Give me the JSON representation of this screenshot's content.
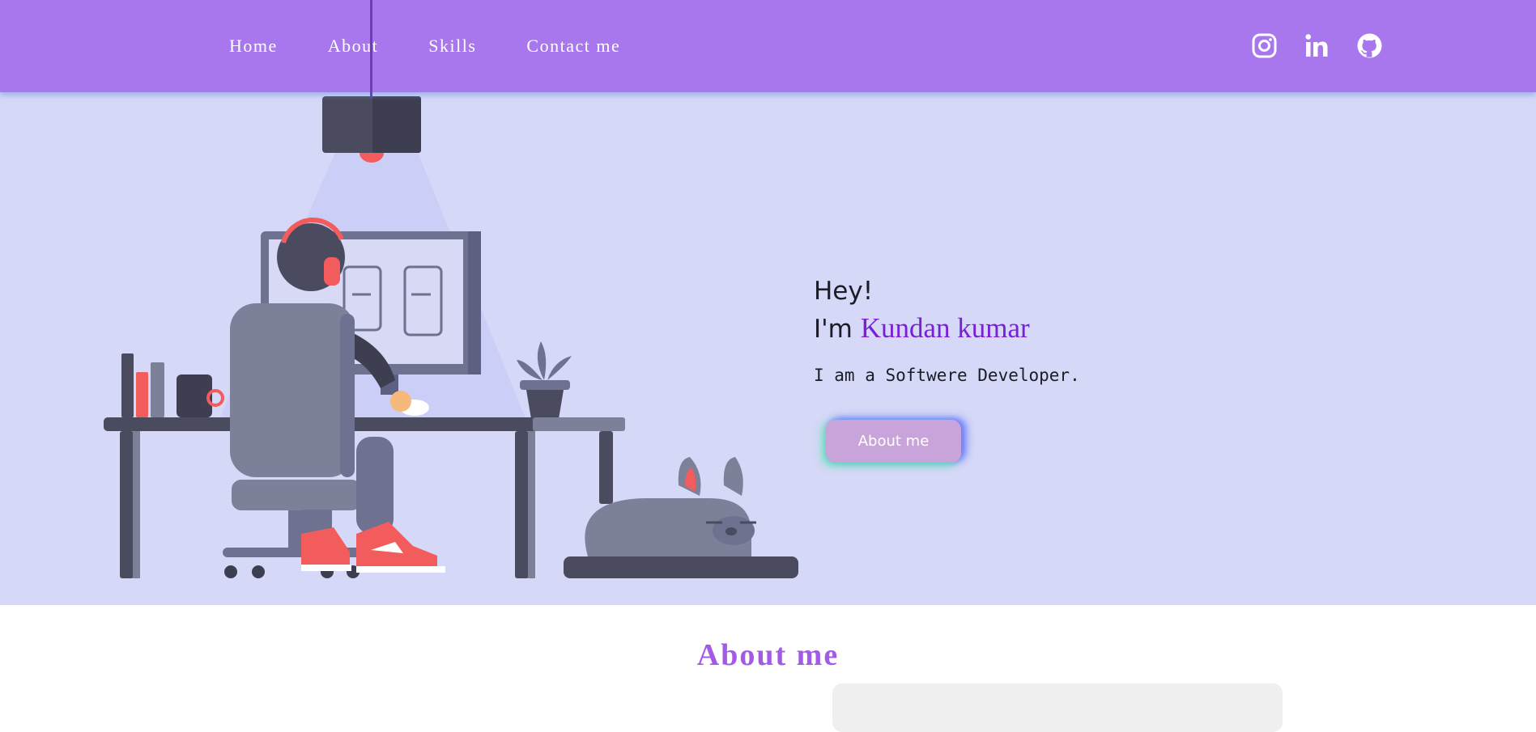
{
  "nav": {
    "links": [
      "Home",
      "About",
      "Skills",
      "Contact me"
    ]
  },
  "social": {
    "icons": [
      "instagram-icon",
      "linkedin-icon",
      "github-icon"
    ]
  },
  "hero": {
    "greeting": "Hey!",
    "im_prefix": "I'm ",
    "name": "Kundan kumar",
    "role": "I am a Softwere Developer.",
    "button_label": "About me"
  },
  "about": {
    "title": "About me"
  },
  "colors": {
    "navbar": "#a877ed",
    "hero_bg": "#d5d8f6",
    "name": "#7a1fd8",
    "about_title": "#a35be6",
    "button": "#c9a4da"
  }
}
